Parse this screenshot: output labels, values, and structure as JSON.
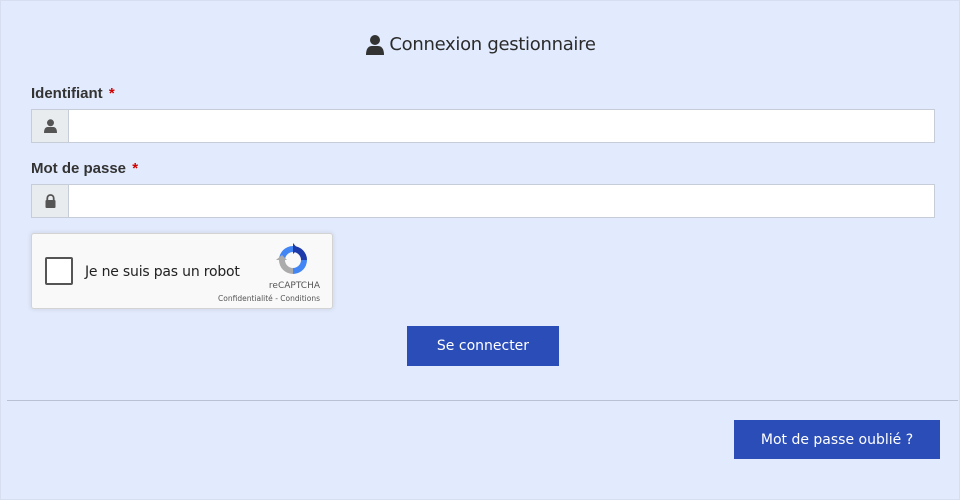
{
  "header": {
    "title": "Connexion gestionnaire",
    "icon": "user-icon"
  },
  "form": {
    "username": {
      "label": "Identifiant",
      "required_marker": "*",
      "value": "",
      "placeholder": "",
      "icon": "user-icon"
    },
    "password": {
      "label": "Mot de passe",
      "required_marker": "*",
      "value": "",
      "placeholder": "",
      "icon": "lock-icon"
    }
  },
  "captcha": {
    "label": "Je ne suis pas un robot",
    "brand": "reCAPTCHA",
    "privacy": "Confidentialité",
    "separator": "-",
    "terms": "Conditions",
    "checked": false
  },
  "actions": {
    "login_label": "Se connecter",
    "forgot_label": "Mot de passe oublié ?"
  },
  "colors": {
    "background": "#e2ebfd",
    "primary_button": "#2b4db8",
    "required": "#d00000"
  }
}
